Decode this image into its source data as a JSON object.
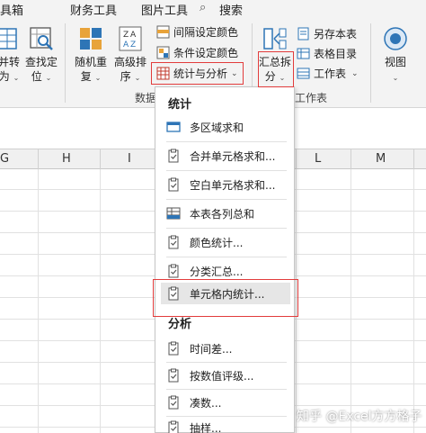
{
  "tabs": [
    "具箱",
    "财务工具",
    "图片工具",
    "搜索"
  ],
  "ribbon": {
    "left_buttons": [
      {
        "label1": "并转",
        "label2": "为"
      },
      {
        "label1": "查找定",
        "label2": "位"
      },
      {
        "label1": "随机重",
        "label2": "复"
      },
      {
        "label1": "高级排",
        "label2": "序"
      }
    ],
    "small_buttons": [
      "间隔设定颜色",
      "条件设定颜色",
      "统计与分析"
    ],
    "summary_button": {
      "label1": "汇总拆",
      "label2": "分"
    },
    "right_small_buttons": [
      "另存本表",
      "表格目录",
      "工作表"
    ],
    "view_button": "视图",
    "group_labels": [
      "数据",
      "工作表"
    ]
  },
  "columns": [
    "G",
    "H",
    "I",
    "L",
    "M"
  ],
  "menu": {
    "sections": [
      {
        "header": "统计",
        "items": [
          "多区域求和",
          "合并单元格求和...",
          "空白单元格求和...",
          "本表各列总和",
          "颜色统计...",
          "分类汇总...",
          "单元格内统计..."
        ]
      },
      {
        "header": "分析",
        "items": [
          "时间差...",
          "按数值评级...",
          "凑数...",
          "抽样..."
        ]
      }
    ]
  },
  "watermark": "知乎 @Excel方方格子",
  "colors": {
    "accent_red": "#e23c3c",
    "icon_blue": "#2e75b6",
    "highlight": "#e6e6e6"
  }
}
